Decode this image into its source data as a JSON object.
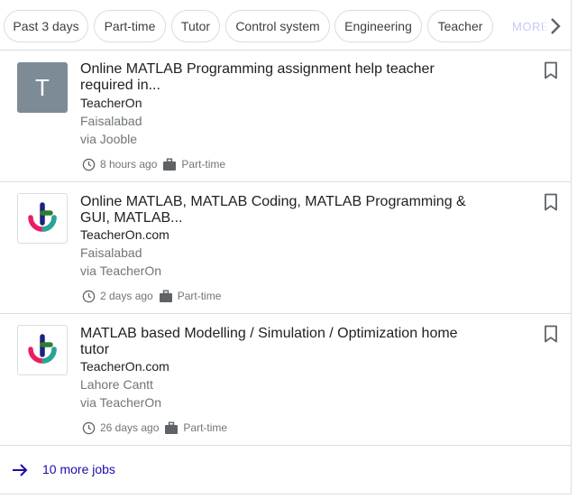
{
  "filters": {
    "chips": [
      "Past 3 days",
      "Part-time",
      "Tutor",
      "Control system",
      "Engineering",
      "Teacher"
    ],
    "more_label": "MORE"
  },
  "jobs": [
    {
      "logo_letter": "T",
      "title": "Online MATLAB Programming assignment help teacher required in...",
      "company": "TeacherOn",
      "location": "Faisalabad",
      "via": "via Jooble",
      "posted": "8 hours ago",
      "type": "Part-time"
    },
    {
      "title": "Online MATLAB, MATLAB Coding, MATLAB Programming & GUI, MATLAB...",
      "company": "TeacherOn.com",
      "location": "Faisalabad",
      "via": "via TeacherOn",
      "posted": "2 days ago",
      "type": "Part-time"
    },
    {
      "title": "MATLAB based Modelling / Simulation / Optimization home tutor",
      "company": "TeacherOn.com",
      "location": "Lahore Cantt",
      "via": "via TeacherOn",
      "posted": "26 days ago",
      "type": "Part-time"
    }
  ],
  "footer": {
    "more_jobs_label": "10 more jobs"
  },
  "colors": {
    "link": "#1a0dab",
    "border": "#dadce0",
    "muted": "#70757a",
    "logo_grey": "#7d8b96"
  }
}
